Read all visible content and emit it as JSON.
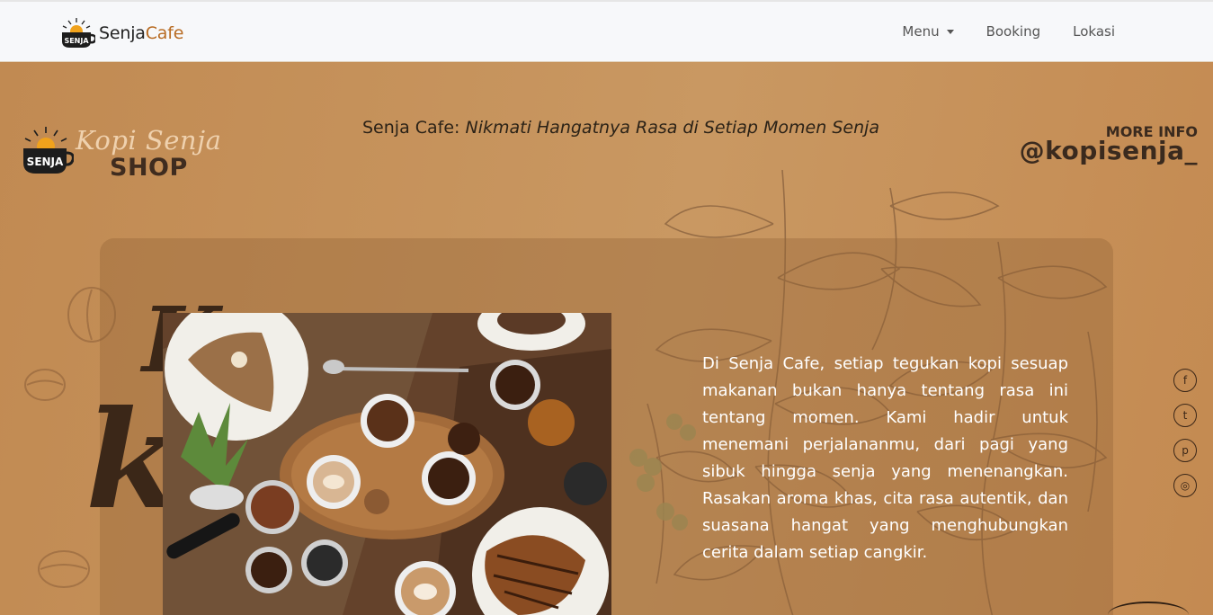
{
  "navbar": {
    "brand_main": "Senja",
    "brand_accent": "Cafe",
    "logo_icon": "coffee-cup-logo-icon",
    "menu_label": "Menu",
    "booking_label": "Booking",
    "lokasi_label": "Lokasi"
  },
  "hero": {
    "kopi_text": "Kopi Senja",
    "shop_text": "SHOP",
    "tagline_prefix": "Senja Cafe: ",
    "tagline_emphasis": "Nikmati Hangatnya Rasa di Setiap Momen Senja",
    "more_info": "MORE INFO",
    "handle": "@kopisenja_",
    "big_1": "K",
    "big_2": "ke",
    "description": "Di Senja Cafe, setiap tegukan kopi sesuap makanan bukan hanya tentang rasa ini tentang momen. Kami hadir untuk menemani perjalananmu, dari pagi yang sibuk hingga senja yang menenangkan. Rasakan aroma khas, cita rasa autentik, dan suasana hangat yang menghubungkan cerita dalam setiap cangkir."
  },
  "socials": [
    {
      "icon": "facebook-icon",
      "glyph": "f"
    },
    {
      "icon": "tiktok-icon",
      "glyph": "t"
    },
    {
      "icon": "pinterest-icon",
      "glyph": "p"
    },
    {
      "icon": "instagram-icon",
      "glyph": "◎"
    }
  ],
  "colors": {
    "accent": "#b86b22",
    "hero_bg": "#c99862",
    "dark_brown": "#3b2718"
  }
}
